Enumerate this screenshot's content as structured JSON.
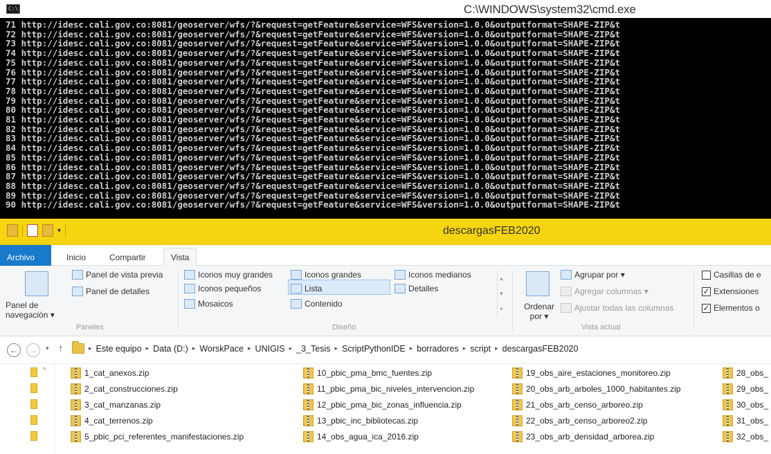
{
  "cmd": {
    "title": "C:\\WINDOWS\\system32\\cmd.exe",
    "icon_label": "C:\\",
    "url": "http://idesc.cali.gov.co:8081/geoserver/wfs/?&request=getFeature&service=WFS&version=1.0.0&outputformat=SHAPE-ZIP&t",
    "line_numbers": [
      "71",
      "72",
      "73",
      "74",
      "75",
      "76",
      "77",
      "78",
      "79",
      "80",
      "81",
      "82",
      "83",
      "84",
      "85",
      "86",
      "87",
      "88",
      "89",
      "90"
    ]
  },
  "explorer": {
    "title": "descargasFEB2020",
    "tabs": [
      "Archivo",
      "Inicio",
      "Compartir",
      "Vista"
    ],
    "ribbon": {
      "panes": {
        "nav_pane": "Panel de navegación ▾",
        "preview": "Panel de vista previa",
        "details": "Panel de detalles",
        "label": "Paneles"
      },
      "layout": {
        "icons_very_large": "Iconos muy grandes",
        "icons_large": "Iconos grandes",
        "icons_medium": "Iconos medianos",
        "icons_small": "Iconos pequeños",
        "list": "Lista",
        "details": "Detalles",
        "tiles": "Mosaicos",
        "content": "Contenido",
        "label": "Diseño"
      },
      "current_view": {
        "sort_by": "Ordenar por ▾",
        "group_by": "Agrupar por ▾",
        "add_columns": "Agregar columnas ▾",
        "fit_columns": "Ajustar todas las columnas",
        "label": "Vista actual"
      },
      "show_hide": {
        "item_checkboxes": "Casillas de e",
        "extensions": "Extensiones",
        "hidden_items": "Elementos o"
      }
    },
    "breadcrumb": [
      "Este equipo",
      "Data (D:)",
      "WorskPace",
      "UNIGIS",
      "_3_Tesis",
      "ScriptPythonIDE",
      "borradores",
      "script",
      "descargasFEB2020"
    ],
    "files": {
      "col1": [
        "1_cat_anexos.zip",
        "2_cat_construcciones.zip",
        "3_cat_manzanas.zip",
        "4_cat_terrenos.zip",
        "5_pbic_pci_referentes_manifestaciones.zip"
      ],
      "col2": [
        "10_pbic_pma_bmc_fuentes.zip",
        "11_pbic_pma_bic_niveles_intervencion.zip",
        "12_pbic_pma_bic_zonas_influencia.zip",
        "13_pbic_inc_bibliotecas.zip",
        "14_obs_agua_ica_2016.zip"
      ],
      "col3": [
        "19_obs_aire_estaciones_monitoreo.zip",
        "20_obs_arb_arboles_1000_habitantes.zip",
        "21_obs_arb_censo_arboreo.zip",
        "22_obs_arb_censo_arboreo2.zip",
        "23_obs_arb_densidad_arborea.zip"
      ],
      "col4": [
        "28_obs_",
        "29_obs_",
        "30_obs_",
        "31_obs_",
        "32_obs_"
      ]
    }
  }
}
